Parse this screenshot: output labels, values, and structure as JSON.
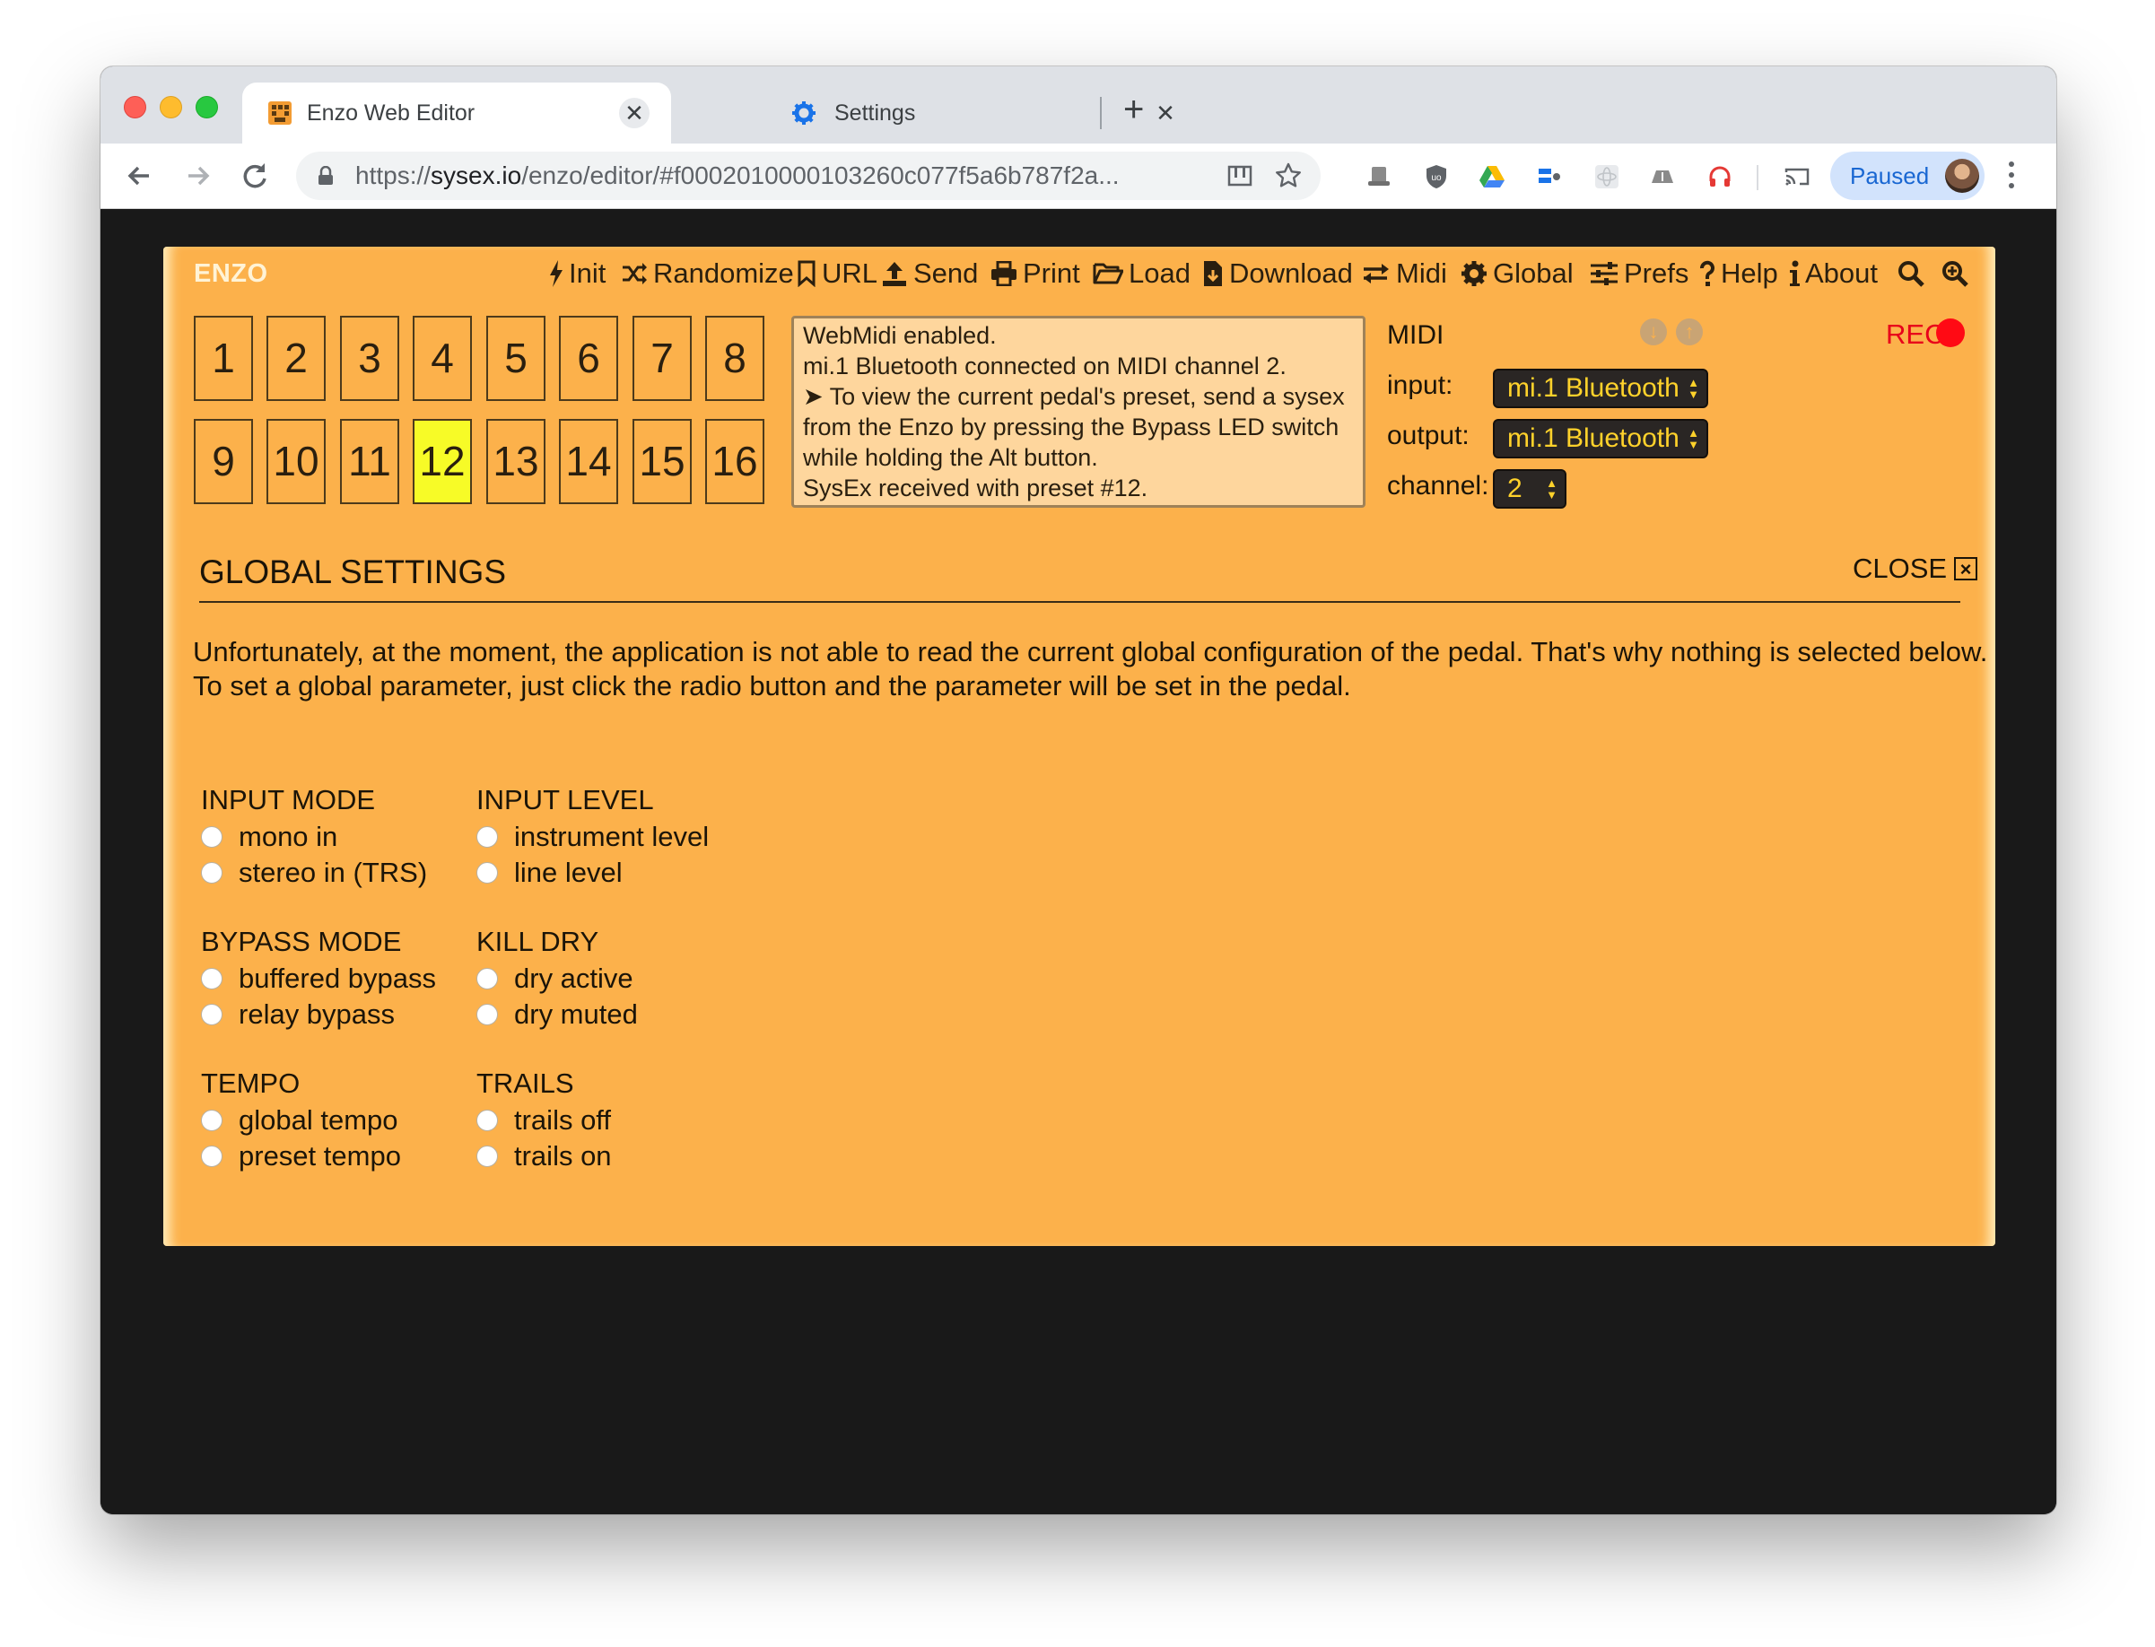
{
  "browser": {
    "tabs": [
      {
        "title": "Enzo Web Editor",
        "active": true
      },
      {
        "title": "Settings",
        "active": false
      }
    ],
    "url_scheme": "https://",
    "url_host": "sysex.io",
    "url_path": "/enzo/editor/#f0002010000103260c077f5a6b787f2a...",
    "profile_label": "Paused",
    "close_glyph": "✕",
    "new_tab_glyph": "+"
  },
  "app": {
    "brand": "ENZO",
    "menu": [
      {
        "label": "Init",
        "icon": "bolt-icon"
      },
      {
        "label": "Randomize",
        "icon": "shuffle-icon"
      },
      {
        "label": "URL",
        "icon": "bookmark-icon"
      },
      {
        "label": "Send",
        "icon": "upload-icon"
      },
      {
        "label": "Print",
        "icon": "print-icon"
      },
      {
        "label": "Load",
        "icon": "folder-open-icon"
      },
      {
        "label": "Download",
        "icon": "file-download-icon"
      },
      {
        "label": "Midi",
        "icon": "exchange-icon"
      },
      {
        "label": "Global",
        "icon": "gear-icon"
      },
      {
        "label": "Prefs",
        "icon": "sliders-icon"
      },
      {
        "label": "Help",
        "icon": "question-icon"
      },
      {
        "label": "About",
        "icon": "info-icon"
      }
    ],
    "presets": [
      "1",
      "2",
      "3",
      "4",
      "5",
      "6",
      "7",
      "8",
      "9",
      "10",
      "11",
      "12",
      "13",
      "14",
      "15",
      "16"
    ],
    "selected_preset": "12",
    "messages": [
      "WebMidi enabled.",
      "mi.1 Bluetooth connected on MIDI channel 2.",
      "➤ To view the current pedal's preset, send a sysex",
      "from the Enzo by pressing the Bypass LED switch",
      "while holding the Alt button.",
      "SysEx received with preset #12."
    ],
    "midi": {
      "title": "MIDI",
      "input_label": "input:",
      "input_value": "mi.1 Bluetooth",
      "output_label": "output:",
      "output_value": "mi.1 Bluetooth",
      "channel_label": "channel:",
      "channel_value": "2"
    },
    "rec_label": "REC",
    "global": {
      "title": "GLOBAL SETTINGS",
      "close_label": "CLOSE",
      "close_glyph": "×",
      "info_line1": "Unfortunately, at the moment, the application is not able to read the current global configuration of the pedal. That's why nothing is selected below.",
      "info_line2": "To set a global parameter, just click the radio button and the parameter will be set in the pedal.",
      "groups": [
        {
          "title": "INPUT MODE",
          "options": [
            "mono in",
            "stereo in (TRS)"
          ]
        },
        {
          "title": "INPUT LEVEL",
          "options": [
            "instrument level",
            "line level"
          ]
        },
        {
          "title": "BYPASS MODE",
          "options": [
            "buffered bypass",
            "relay bypass"
          ]
        },
        {
          "title": "KILL DRY",
          "options": [
            "dry active",
            "dry muted"
          ]
        },
        {
          "title": "TEMPO",
          "options": [
            "global tempo",
            "preset tempo"
          ]
        },
        {
          "title": "TRAILS",
          "options": [
            "trails off",
            "trails on"
          ]
        }
      ]
    }
  },
  "colors": {
    "panel": "#fcb14b",
    "selected_preset": "#f7fb27",
    "rec": "#ff0a14",
    "select_text": "#ffd22b"
  }
}
